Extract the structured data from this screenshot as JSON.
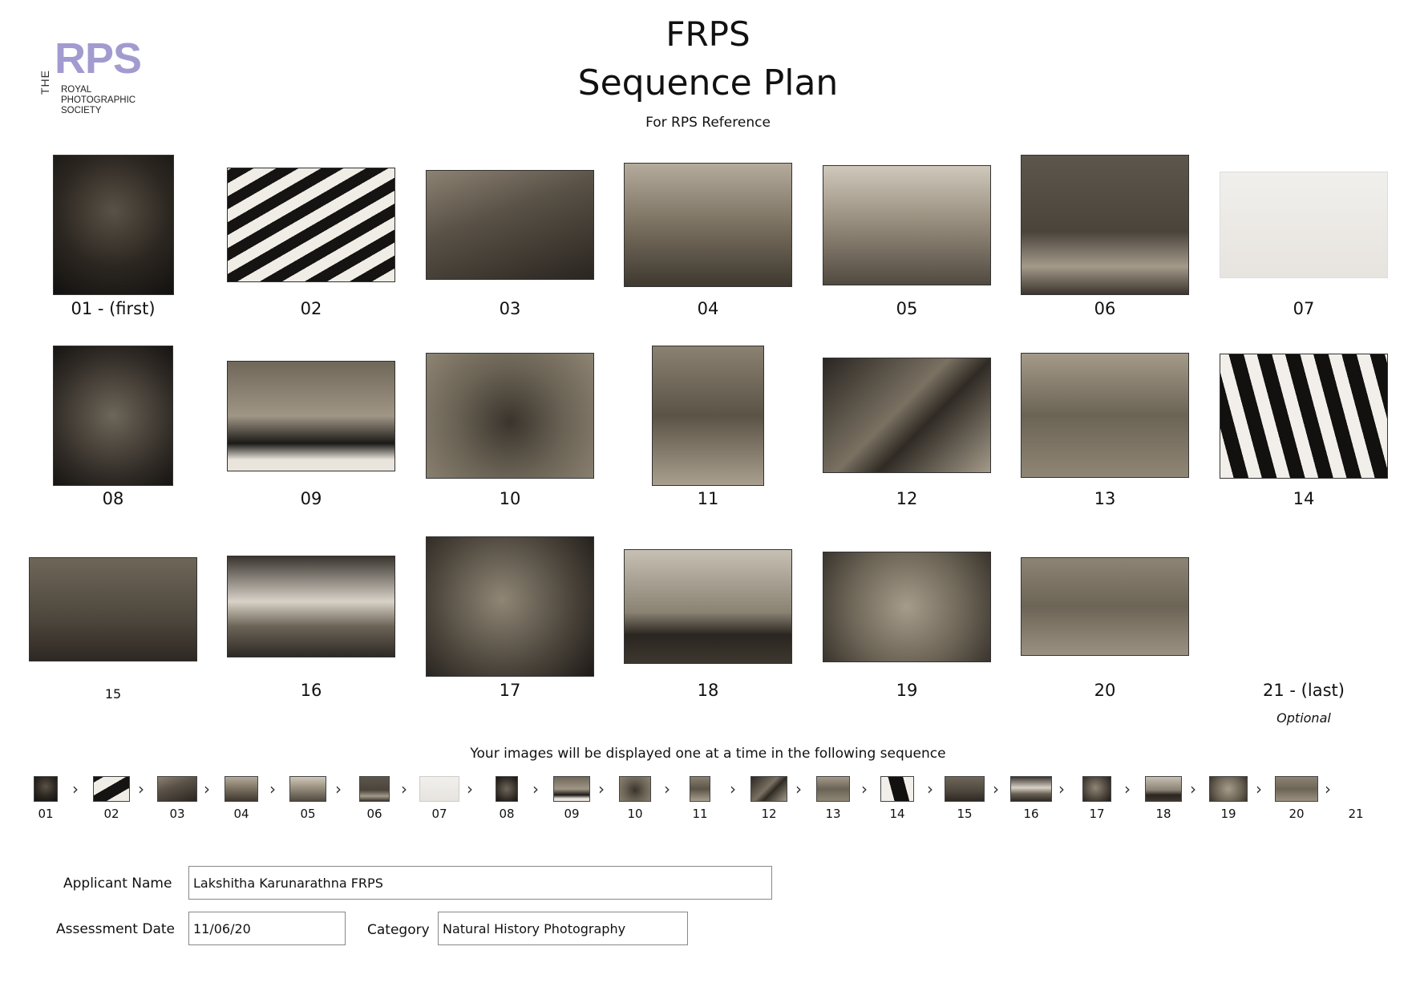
{
  "header": {
    "logo_the": "THE",
    "logo_rps": "RPS",
    "logo_sub": [
      "ROYAL",
      "PHOTOGRAPHIC",
      "SOCIETY"
    ],
    "title": "FRPS",
    "subtitle_main": "Sequence Plan",
    "reference": "For RPS Reference"
  },
  "photos": [
    {
      "label": "01 - (first)"
    },
    {
      "label": "02"
    },
    {
      "label": "03"
    },
    {
      "label": "04"
    },
    {
      "label": "05"
    },
    {
      "label": "06"
    },
    {
      "label": "07"
    },
    {
      "label": "08"
    },
    {
      "label": "09"
    },
    {
      "label": "10"
    },
    {
      "label": "11"
    },
    {
      "label": "12"
    },
    {
      "label": "13"
    },
    {
      "label": "14"
    },
    {
      "label": "15"
    },
    {
      "label": "16"
    },
    {
      "label": "17"
    },
    {
      "label": "18"
    },
    {
      "label": "19"
    },
    {
      "label": "20"
    },
    {
      "label": "21 - (last)",
      "note": "Optional"
    }
  ],
  "sequence": {
    "caption": "Your images will be displayed one at a time in the following sequence",
    "labels": [
      "01",
      "02",
      "03",
      "04",
      "05",
      "06",
      "07",
      "08",
      "09",
      "10",
      "11",
      "12",
      "13",
      "14",
      "15",
      "16",
      "17",
      "18",
      "19",
      "20",
      "21"
    ],
    "arrow": "›"
  },
  "form": {
    "applicant_label": "Applicant Name",
    "applicant_value": "Lakshitha Karunarathna FRPS",
    "date_label": "Assessment Date",
    "date_value": "11/06/20",
    "category_label": "Category",
    "category_value": "Natural History Photography"
  }
}
